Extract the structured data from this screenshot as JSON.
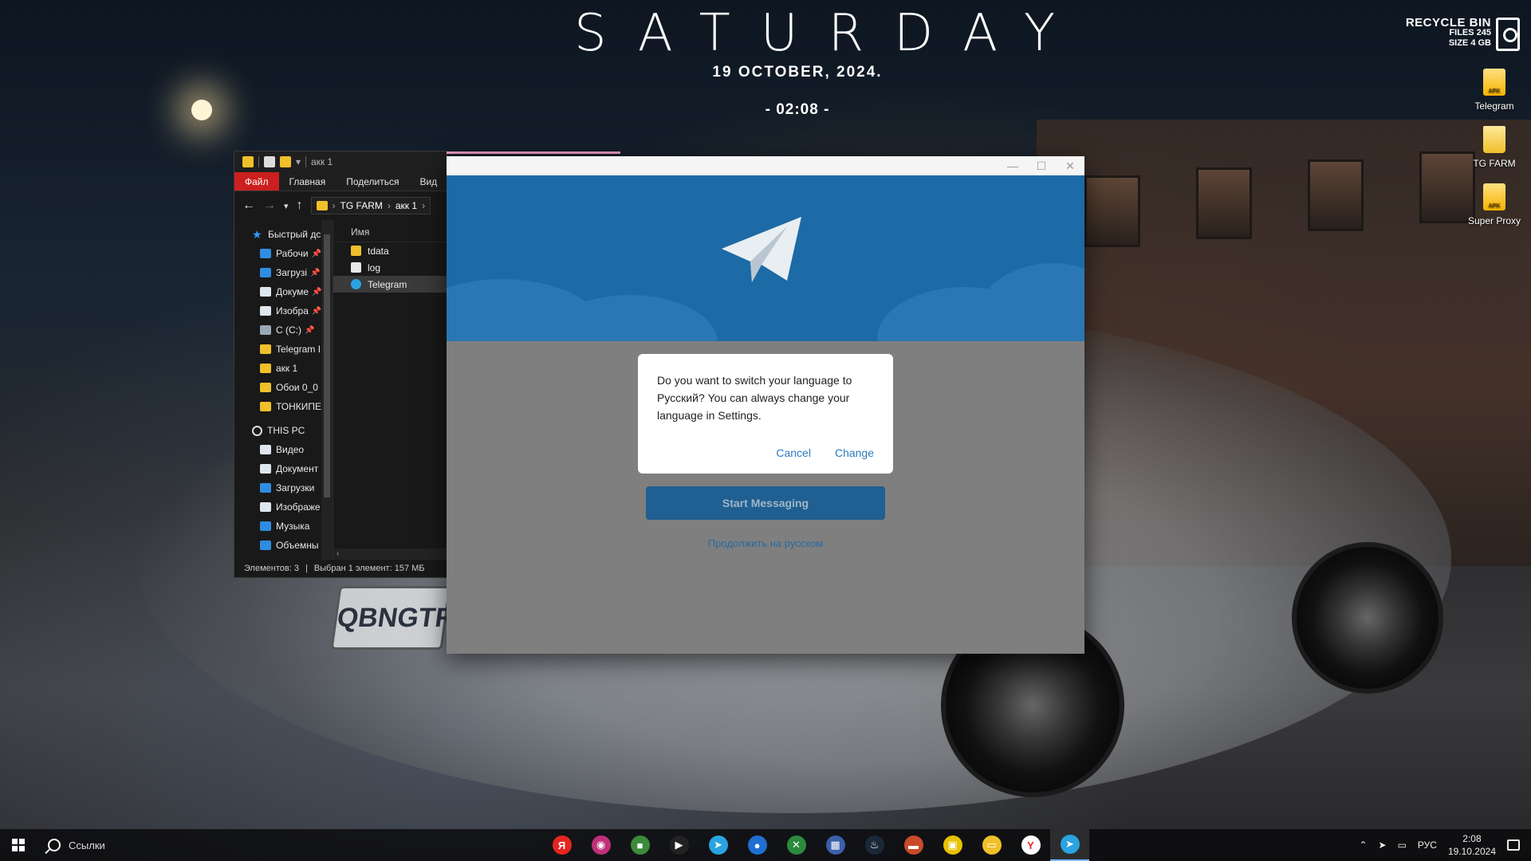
{
  "desktop": {
    "day": "SATURDAY",
    "date": "19  OCTOBER, 2024.",
    "time": "- 02:08 -",
    "recycle_bin": {
      "title": "RECYCLE BIN",
      "files": "FILES 245",
      "size": "SIZE 4 GB"
    },
    "icons": [
      {
        "label": "Telegram",
        "icon": "apk-icon"
      },
      {
        "label": "TG FARM",
        "icon": "folder-icon"
      },
      {
        "label": "Super Proxy",
        "icon": "apk-icon"
      }
    ]
  },
  "explorer": {
    "title": "акк 1",
    "ribbon": {
      "file": "Файл",
      "home": "Главная",
      "share": "Поделиться",
      "view": "Вид"
    },
    "breadcrumb": [
      "TG FARM",
      "акк 1"
    ],
    "nav": {
      "quick_access": "Быстрый дс",
      "quick_items": [
        "Рабочи",
        "Загрузі",
        "Докуме",
        "Изобра",
        "C (C:)",
        "Telegram I",
        "акк 1",
        "Обои 0_0",
        "ТОНКИПЕ"
      ],
      "this_pc": "THIS PC",
      "pc_items": [
        "Видео",
        "Документ",
        "Загрузки",
        "Изображе",
        "Музыка",
        "Объемны"
      ]
    },
    "column_name": "Имя",
    "files": [
      {
        "name": "tdata",
        "type": "folder"
      },
      {
        "name": "log",
        "type": "doc"
      },
      {
        "name": "Telegram",
        "type": "tg"
      }
    ],
    "status": {
      "count": "Элементов: 3",
      "selected": "Выбран 1 элемент: 157 МБ"
    }
  },
  "telegram": {
    "dialog_text": "Do you want to switch your language to Русский? You can always change your language in Settings.",
    "cancel": "Cancel",
    "change": "Change",
    "start": "Start Messaging",
    "continue_russian": "Продолжить на русском"
  },
  "taskbar": {
    "search_label": "Ссылки",
    "apps": [
      {
        "name": "yandex-icon",
        "color": "#e52620",
        "glyph": "Я"
      },
      {
        "name": "music-icon",
        "color": "#c0307a",
        "glyph": "◉"
      },
      {
        "name": "cube-icon",
        "color": "#3a8a3a",
        "glyph": "■"
      },
      {
        "name": "play-icon",
        "color": "#222222",
        "glyph": "▶"
      },
      {
        "name": "telegram-icon",
        "color": "#2aa3e0",
        "glyph": "➤"
      },
      {
        "name": "drop-icon",
        "color": "#1f6fd1",
        "glyph": "●"
      },
      {
        "name": "xbox-icon",
        "color": "#2d8a3c",
        "glyph": "✕"
      },
      {
        "name": "calculator-icon",
        "color": "#3b5fa8",
        "glyph": "▦"
      },
      {
        "name": "steam-icon",
        "color": "#1b2838",
        "glyph": "♨"
      },
      {
        "name": "flag-icon",
        "color": "#c84a2a",
        "glyph": "▬"
      },
      {
        "name": "app-icon",
        "color": "#e6c200",
        "glyph": "▣"
      },
      {
        "name": "folder-icon",
        "color": "#f0c02a",
        "glyph": "▭"
      },
      {
        "name": "yandex-browser-icon",
        "color": "#ffffff",
        "glyph": "Y"
      },
      {
        "name": "telegram-active-icon",
        "color": "#2aa3e0",
        "glyph": "➤"
      }
    ],
    "tray": {
      "lang": "РУС",
      "time": "2:08",
      "date": "19.10.2024"
    }
  }
}
